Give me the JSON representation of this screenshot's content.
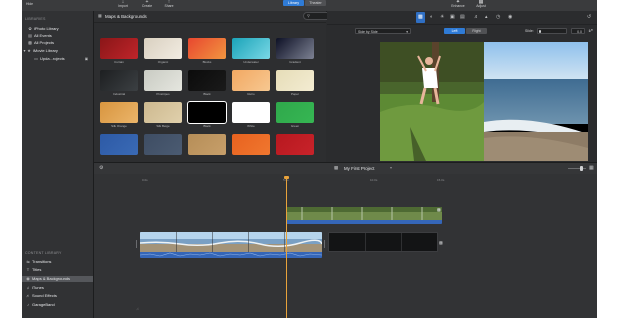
{
  "toolbar": {
    "hide_label": "Hide",
    "import_label": "Import",
    "create_label": "Create",
    "share_label": "Share",
    "tab_library": "Library",
    "tab_theater": "Theater",
    "enhance_label": "Enhance",
    "adjust_label": "Adjust"
  },
  "sidebar": {
    "libraries_heading": "LIBRARIES",
    "libraries": [
      {
        "label": "iPhoto Library",
        "icon": "photo-icon"
      },
      {
        "label": "All Events",
        "icon": "calendar-icon"
      },
      {
        "label": "All Projects",
        "icon": "film-icon"
      },
      {
        "label": "iMovie Library",
        "icon": "star-icon"
      },
      {
        "label": "Upda...rojects",
        "icon": "folder-icon"
      }
    ],
    "content_heading": "CONTENT LIBRARY",
    "content": [
      {
        "label": "Transitions",
        "icon": "transitions-icon"
      },
      {
        "label": "Titles",
        "icon": "titles-icon"
      },
      {
        "label": "Maps & Backgrounds",
        "icon": "globe-icon"
      },
      {
        "label": "iTunes",
        "icon": "music-icon"
      },
      {
        "label": "Sound Effects",
        "icon": "speaker-icon"
      },
      {
        "label": "GarageBand",
        "icon": "guitar-icon"
      }
    ]
  },
  "browser": {
    "title": "Maps & Backgrounds",
    "search_placeholder": "",
    "tiles": [
      {
        "label": "Curtain",
        "color": "#8a1618",
        "color2": "#c0252a"
      },
      {
        "label": "Organic",
        "color": "#d9d0c0",
        "color2": "#f2ece2"
      },
      {
        "label": "Blocks",
        "color": "#e8472f",
        "color2": "#f29640"
      },
      {
        "label": "Underwater",
        "color": "#1aa3b8",
        "color2": "#7ad8e6"
      },
      {
        "label": "Gradient",
        "color": "#0d1025",
        "color2": "#7d8293"
      },
      {
        "label": "Industrial",
        "color": "#1d1f21",
        "color2": "#3c4043"
      },
      {
        "label": "Pinstripes",
        "color": "#c9cbc3",
        "color2": "#e5e6df"
      },
      {
        "label": "Black",
        "color": "#0b0b0b",
        "color2": "#1a1a1a"
      },
      {
        "label": "Retro",
        "color": "#f2a862",
        "color2": "#f7c891"
      },
      {
        "label": "Paper",
        "color": "#e6ddb8",
        "color2": "#f3ecd2"
      },
      {
        "label": "Silk Orange",
        "color": "#d8953f",
        "color2": "#ebb56a"
      },
      {
        "label": "Silk Beige",
        "color": "#cdb98f",
        "color2": "#e0d0ac"
      },
      {
        "label": "Black",
        "color": "#000000",
        "color2": "#000000"
      },
      {
        "label": "White",
        "color": "#ffffff",
        "color2": "#ffffff"
      },
      {
        "label": "Green",
        "color": "#2fa84b",
        "color2": "#36b653"
      },
      {
        "label": "",
        "color": "#2d5aa6",
        "color2": "#3a6ab5"
      },
      {
        "label": "",
        "color": "#3e4d63",
        "color2": "#4b5b72"
      },
      {
        "label": "",
        "color": "#b68e58",
        "color2": "#c79f6a"
      },
      {
        "label": "",
        "color": "#e8621f",
        "color2": "#f0772f"
      },
      {
        "label": "",
        "color": "#b7181f",
        "color2": "#c8232a"
      }
    ]
  },
  "viewer": {
    "style_value": "Side by Side",
    "left_label": "Left",
    "right_label": "Right",
    "slide_label": "Slide:",
    "slide_value": "0.0"
  },
  "timeline": {
    "project_title": "My First Project",
    "ticks": [
      "0.0s",
      "5.0s",
      "10.0s",
      "15.0s"
    ]
  },
  "colors": {
    "accent": "#2f7bd6",
    "playhead": "#e8a33b",
    "audio": "#3566b8"
  }
}
